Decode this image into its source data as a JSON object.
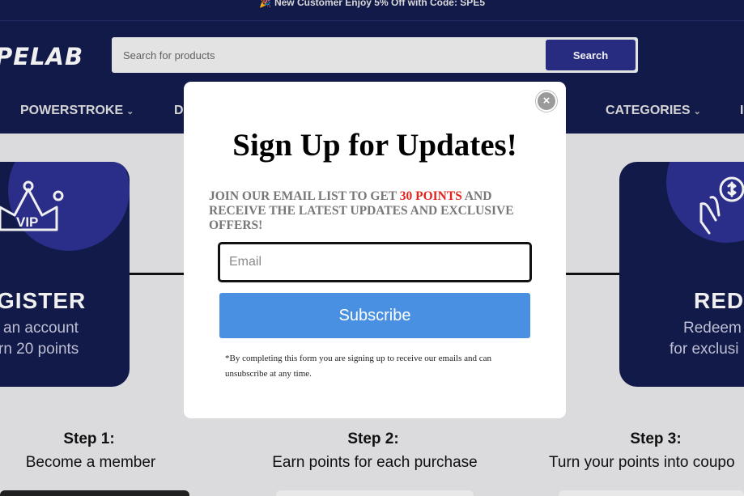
{
  "announcement": {
    "icon": "party-popper-icon",
    "text": "New Customer Enjoy 5% Off with Code: SPE5"
  },
  "header": {
    "logo": "PELAB",
    "search": {
      "placeholder": "Search for products",
      "button": "Search"
    }
  },
  "nav": {
    "powerstroke": "POWERSTROKE",
    "d": "D",
    "categories": "CATEGORIES",
    "edge": "I"
  },
  "cards": {
    "left": {
      "icon": "crown-vip-icon",
      "icon_text": "VIP",
      "title": "GISTER",
      "line1": "an account",
      "line2": "rn 20 points"
    },
    "right": {
      "icon": "money-hands-icon",
      "title": "REDE",
      "line1": "Redeem",
      "line2": "for exclusi"
    }
  },
  "steps": [
    {
      "title": "Step 1:",
      "desc": "Become a member"
    },
    {
      "title": "Step 2:",
      "desc": "Earn points for each purchase"
    },
    {
      "title": "Step 3:",
      "desc": "Turn your points into coupo"
    }
  ],
  "modal": {
    "title": "Sign Up for Updates!",
    "subtitle_pre": "JOIN OUR EMAIL LIST TO GET ",
    "subtitle_points": "30 POINTS",
    "subtitle_post": " AND RECEIVE THE LATEST UPDATES AND EXCLUSIVE OFFERS!",
    "email_placeholder": "Email",
    "subscribe": "Subscribe",
    "disclaimer": "*By completing this form you are signing up to receive our emails and can unsubscribe at any time.",
    "close": "×"
  },
  "colors": {
    "navy": "#141c4e",
    "accent": "#2d3192",
    "subscribe_blue": "#4a90e2",
    "points_red": "#e3231b"
  }
}
